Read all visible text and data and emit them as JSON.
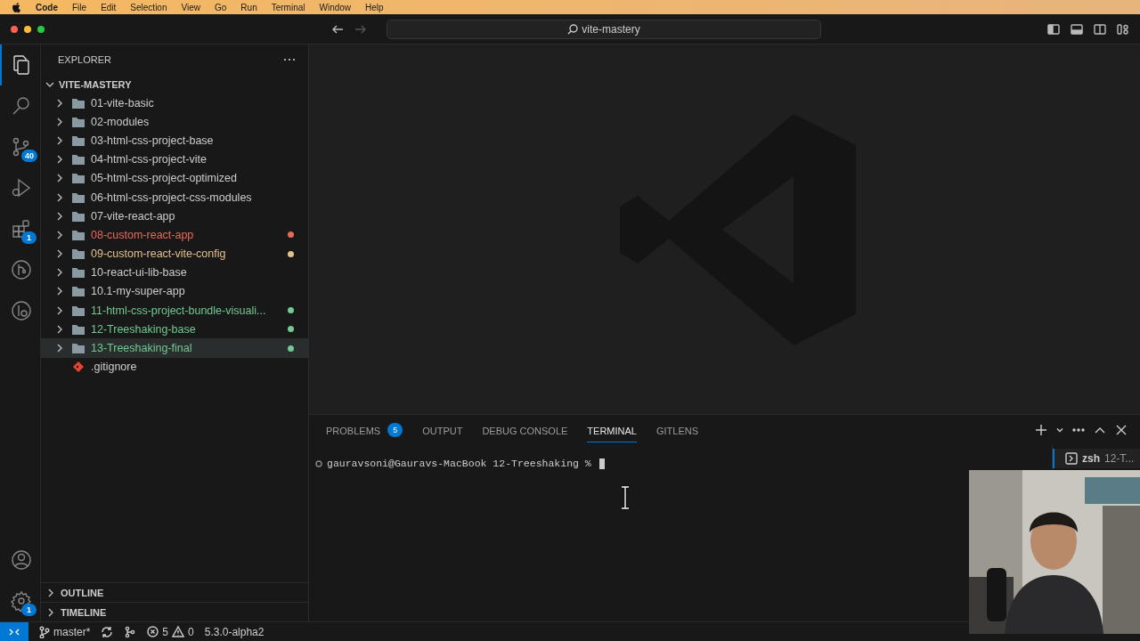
{
  "menu_bar": {
    "app": "Code",
    "items": [
      "File",
      "Edit",
      "Selection",
      "View",
      "Go",
      "Run",
      "Terminal",
      "Window",
      "Help"
    ]
  },
  "title_bar": {
    "search": "vite-mastery"
  },
  "activity_bar": {
    "items": [
      {
        "kind": "explorer",
        "selected": true
      },
      {
        "kind": "search",
        "selected": false
      },
      {
        "kind": "scm",
        "selected": false,
        "badge": "40"
      },
      {
        "kind": "debug",
        "selected": false
      },
      {
        "kind": "extensions",
        "selected": false,
        "badge": "1"
      },
      {
        "kind": "gitlens",
        "selected": false
      },
      {
        "kind": "inspect",
        "selected": false
      }
    ],
    "bottom": [
      {
        "kind": "account"
      },
      {
        "kind": "settings",
        "badge": "1"
      }
    ]
  },
  "sidebar": {
    "title": "EXPLORER",
    "root": {
      "label": "VITE-MASTERY",
      "expanded": true,
      "children": [
        {
          "kind": "folder",
          "label": "01-vite-basic",
          "expanded": false,
          "selected": false
        },
        {
          "kind": "folder",
          "label": "02-modules",
          "expanded": false,
          "selected": false
        },
        {
          "kind": "folder",
          "label": "03-html-css-project-base",
          "expanded": false,
          "selected": false
        },
        {
          "kind": "folder",
          "label": "04-html-css-project-vite",
          "expanded": false,
          "selected": false
        },
        {
          "kind": "folder",
          "label": "05-html-css-project-optimized",
          "expanded": false,
          "selected": false
        },
        {
          "kind": "folder",
          "label": "06-html-css-project-css-modules",
          "expanded": false,
          "selected": false
        },
        {
          "kind": "folder",
          "label": "07-vite-react-app",
          "expanded": false,
          "selected": false
        },
        {
          "kind": "folder",
          "label": "08-custom-react-app",
          "expanded": false,
          "selected": false,
          "color": "#e8695a"
        },
        {
          "kind": "folder",
          "label": "09-custom-react-vite-config",
          "expanded": false,
          "selected": false,
          "color": "#e2c08d"
        },
        {
          "kind": "folder",
          "label": "10-react-ui-lib-base",
          "expanded": false,
          "selected": false
        },
        {
          "kind": "folder",
          "label": "10.1-my-super-app",
          "expanded": false,
          "selected": false
        },
        {
          "kind": "folder",
          "label": "11-html-css-project-bundle-visuali...",
          "expanded": false,
          "selected": false,
          "color": "#73c991"
        },
        {
          "kind": "folder",
          "label": "12-Treeshaking-base",
          "expanded": false,
          "selected": false,
          "color": "#73c991"
        },
        {
          "kind": "folder",
          "label": "13-Treeshaking-final",
          "expanded": false,
          "selected": true,
          "color": "#73c991"
        },
        {
          "kind": "git",
          "label": ".gitignore",
          "selected": false
        }
      ]
    },
    "sections": [
      {
        "label": "OUTLINE",
        "expanded": false
      },
      {
        "label": "TIMELINE",
        "expanded": false
      }
    ]
  },
  "panel": {
    "tabs": [
      {
        "label": "PROBLEMS",
        "selected": false,
        "badge": "5"
      },
      {
        "label": "OUTPUT",
        "selected": false
      },
      {
        "label": "DEBUG CONSOLE",
        "selected": false
      },
      {
        "label": "TERMINAL",
        "selected": true
      },
      {
        "label": "GITLENS",
        "selected": false
      }
    ],
    "terminal": {
      "prompt": "gauravsoni@Gauravs-MacBook 12-Treeshaking %"
    },
    "terminal_list": [
      {
        "name": "zsh",
        "folder": "12-T...",
        "selected": true
      }
    ]
  },
  "status_bar": {
    "branch": "master*",
    "errors": "5",
    "warnings": "0",
    "version": "5.3.0-alpha2"
  }
}
